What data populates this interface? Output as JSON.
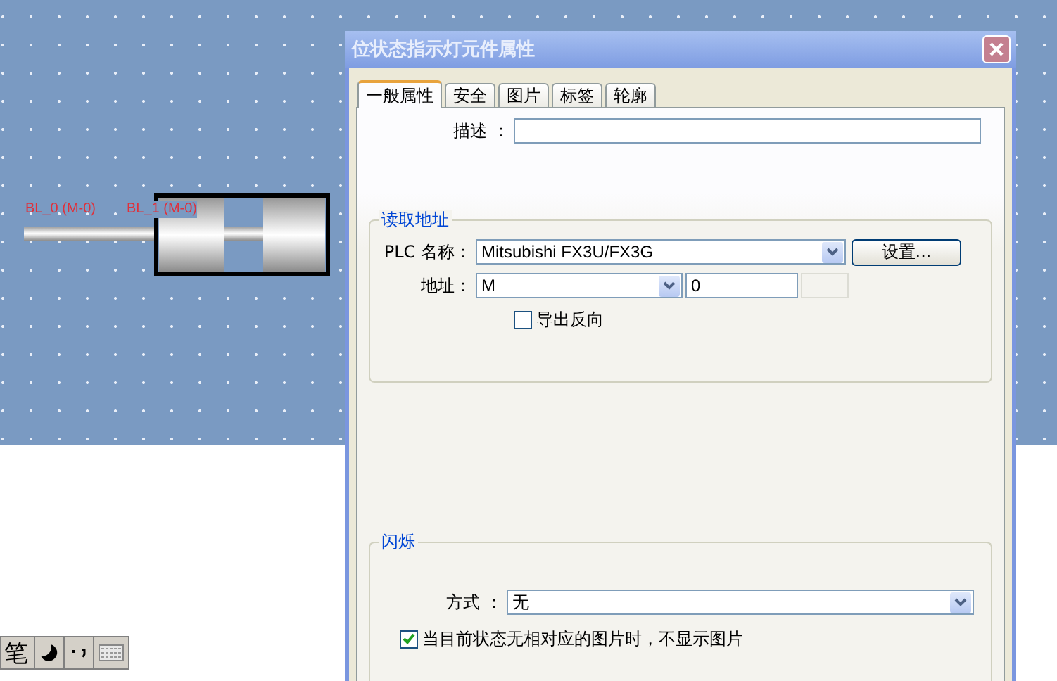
{
  "canvas": {
    "labels": [
      {
        "text": "BL_0 (M-0)"
      },
      {
        "text": "BL_1 (M-0)"
      }
    ]
  },
  "dialog": {
    "title": "位状态指示灯元件属性",
    "tabs": [
      {
        "label": "一般属性",
        "selected": true
      },
      {
        "label": "安全",
        "selected": false
      },
      {
        "label": "图片",
        "selected": false
      },
      {
        "label": "标签",
        "selected": false
      },
      {
        "label": "轮廓",
        "selected": false
      }
    ],
    "description": {
      "label": "描述 ："
    },
    "read_address": {
      "title": "读取地址",
      "plc_label": "PLC 名称：",
      "plc_value": "Mitsubishi FX3U/FX3G",
      "settings_button": "设置...",
      "address_label": "地址：",
      "device_value": "M",
      "address_value": "0",
      "invert": {
        "label": "导出反向",
        "checked": false
      }
    },
    "blink": {
      "title": "闪烁",
      "mode_label": "方式 ：",
      "mode_value": "无",
      "hide_image": {
        "label": "当目前状态无相对应的图片时，不显示图片",
        "checked": true
      }
    }
  },
  "ime_bar": {
    "text": "笔"
  }
}
